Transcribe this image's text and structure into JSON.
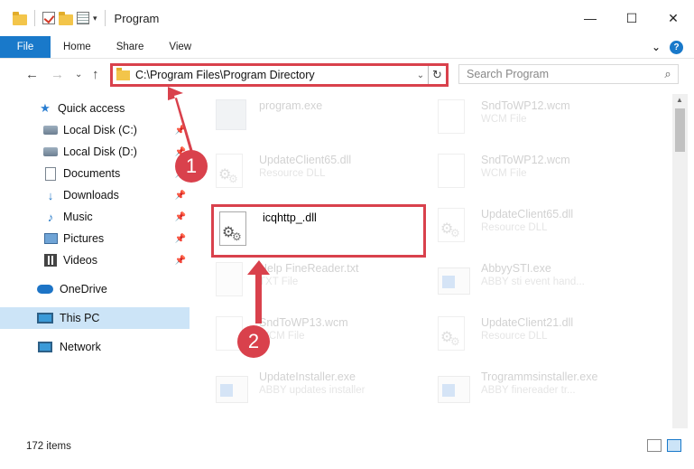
{
  "window": {
    "title": "Program",
    "controls": {
      "minimize": "—",
      "maximize": "☐",
      "close": "✕"
    }
  },
  "ribbon": {
    "tabs": [
      "File",
      "Home",
      "Share",
      "View"
    ],
    "expand_glyph": "⌄",
    "help_glyph": "?"
  },
  "navigation": {
    "back": "←",
    "forward": "→",
    "recent": "⌄",
    "up": "↑"
  },
  "address": {
    "path": "C:\\Program Files\\Program Directory",
    "dropdown": "⌄",
    "refresh": "↻"
  },
  "search": {
    "placeholder": "Search Program",
    "icon": "⌕"
  },
  "sidebar": {
    "items": [
      {
        "label": "Quick access",
        "icon": "star-icon"
      },
      {
        "label": "Local Disk (C:)",
        "icon": "disk-icon",
        "pinned": true
      },
      {
        "label": "Local Disk (D:)",
        "icon": "disk-icon",
        "pinned": true
      },
      {
        "label": "Documents",
        "icon": "document-icon",
        "pinned": true
      },
      {
        "label": "Downloads",
        "icon": "download-icon",
        "pinned": true
      },
      {
        "label": "Music",
        "icon": "music-icon",
        "pinned": true
      },
      {
        "label": "Pictures",
        "icon": "pictures-icon",
        "pinned": true
      },
      {
        "label": "Videos",
        "icon": "videos-icon",
        "pinned": true
      },
      {
        "label": "OneDrive",
        "icon": "cloud-icon"
      },
      {
        "label": "This PC",
        "icon": "pc-icon",
        "selected": true
      },
      {
        "label": "Network",
        "icon": "network-icon"
      }
    ]
  },
  "files": [
    {
      "name": "program.exe",
      "type": "",
      "icon": "setup-icon",
      "highlighted": false
    },
    {
      "name": "SndToWP12.wcm",
      "type": "WCM File",
      "icon": "page-icon",
      "highlighted": false
    },
    {
      "name": "UpdateClient65.dll",
      "type": "Resource DLL",
      "icon": "dll-icon",
      "highlighted": false
    },
    {
      "name": "SndToWP12.wcm",
      "type": "WCM File",
      "icon": "page-icon",
      "highlighted": false
    },
    {
      "name": "icqhttp_.dll",
      "type": "",
      "icon": "dll-icon",
      "highlighted": true
    },
    {
      "name": "UpdateClient65.dll",
      "type": "Resource DLL",
      "icon": "dll-icon",
      "highlighted": false
    },
    {
      "name": "Help FineReader.txt",
      "type": "TXT File",
      "icon": "txt-icon",
      "highlighted": false
    },
    {
      "name": "AbbyySTI.exe",
      "type": "ABBY sti event hand...",
      "icon": "exe-icon",
      "highlighted": false
    },
    {
      "name": "SndToWP13.wcm",
      "type": "WCM File",
      "icon": "page-icon",
      "highlighted": false
    },
    {
      "name": "UpdateClient21.dll",
      "type": "Resource DLL",
      "icon": "dll-icon",
      "highlighted": false
    },
    {
      "name": "UpdateInstaller.exe",
      "type": "ABBY updates installer",
      "icon": "exe-icon",
      "highlighted": false
    },
    {
      "name": "Trogrammsinstaller.exe",
      "type": "ABBY finereader tr...",
      "icon": "exe-icon",
      "highlighted": false
    }
  ],
  "status": {
    "count": "172 items"
  },
  "annotations": {
    "badge1": "1",
    "badge2": "2",
    "color": "#d9414c"
  }
}
